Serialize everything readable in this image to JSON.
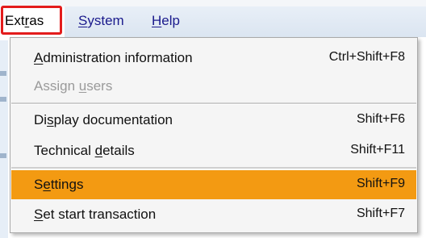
{
  "menubar": {
    "items": [
      {
        "pre": "Ext",
        "u": "r",
        "post": "as"
      },
      {
        "pre": "",
        "u": "S",
        "post": "ystem"
      },
      {
        "pre": "",
        "u": "H",
        "post": "elp"
      }
    ]
  },
  "dropdown": {
    "items": [
      {
        "pre": "",
        "u": "A",
        "post": "dministration information",
        "shortcut": "Ctrl+Shift+F8",
        "disabled": false
      },
      {
        "pre": "Assign ",
        "u": "u",
        "post": "sers",
        "shortcut": "",
        "disabled": true
      },
      {
        "pre": "Di",
        "u": "s",
        "post": "play documentation",
        "shortcut": "Shift+F6",
        "disabled": false
      },
      {
        "pre": "Technical ",
        "u": "d",
        "post": "etails",
        "shortcut": "Shift+F11",
        "disabled": false
      },
      {
        "pre": "S",
        "u": "e",
        "post": "ttings",
        "shortcut": "Shift+F9",
        "disabled": false,
        "highlighted": true
      },
      {
        "pre": "",
        "u": "S",
        "post": "et start transaction",
        "shortcut": "Shift+F7",
        "disabled": false
      }
    ]
  },
  "colors": {
    "highlight": "#f39a12",
    "annotation_box": "#e31c1c",
    "menu_link": "#1a1a8c"
  }
}
